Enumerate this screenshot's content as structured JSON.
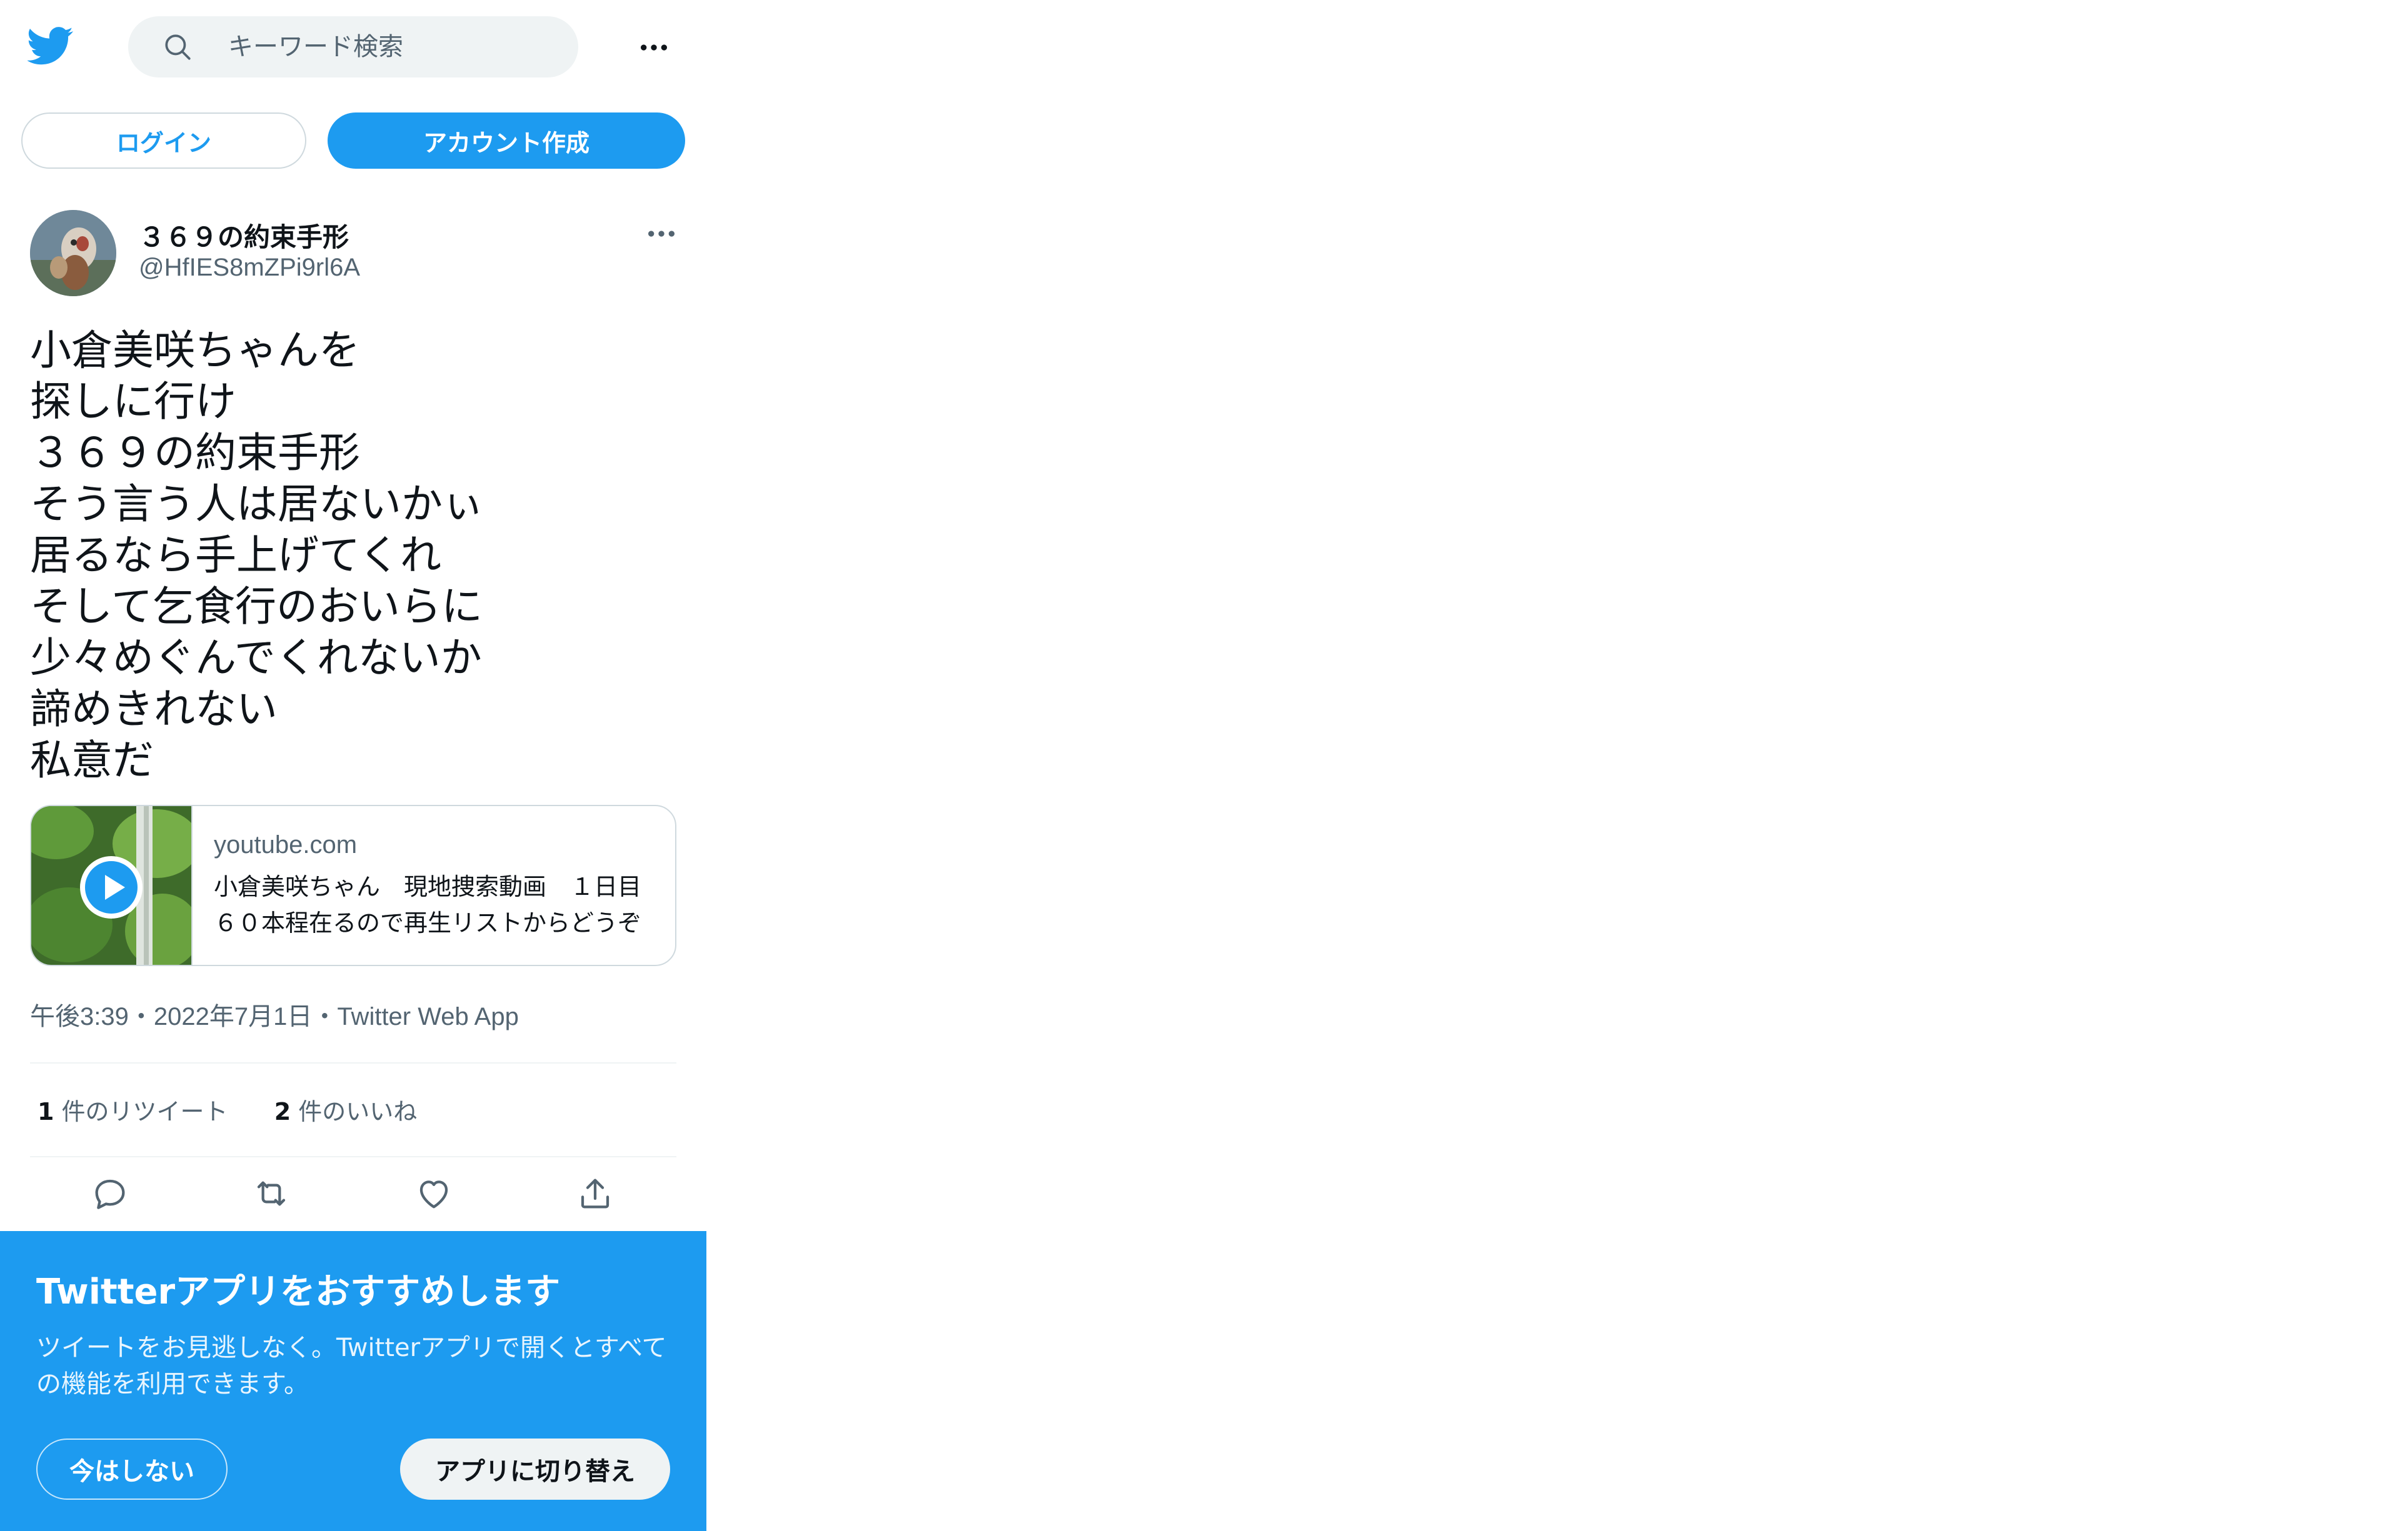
{
  "header": {
    "logo_icon": "twitter-bird-icon",
    "search_placeholder": "キーワード検索",
    "more_icon": "more-horizontal-icon"
  },
  "auth": {
    "login_label": "ログイン",
    "signup_label": "アカウント作成"
  },
  "tweet": {
    "display_name": "３６９の約束手形",
    "handle": "@HfIES8mZPi9rl6A",
    "lines": [
      "小倉美咲ちゃんを",
      "探しに行け",
      "３６９の約束手形",
      "そう言う人は居ないかぃ",
      "居るなら手上げてくれ",
      "そして乞食行のおいらに",
      "少々めぐんでくれないか",
      "諦めきれない",
      "私意だ"
    ],
    "card": {
      "domain": "youtube.com",
      "title": "小倉美咲ちゃん　現地捜索動画　１日目　６０本程在るので再生リストからどうぞ"
    },
    "meta": "午後3:39・2022年7月1日・Twitter Web App",
    "stats": {
      "retweets_count": "1",
      "retweets_label": "件のリツイート",
      "likes_count": "2",
      "likes_label": "件のいいね"
    }
  },
  "banner": {
    "title": "Twitterアプリをおすすめします",
    "text": "ツイートをお見逃しなく。Twitterアプリで開くとすべての機能を利用できます。",
    "not_now_label": "今はしない",
    "switch_label": "アプリに切り替え"
  },
  "colors": {
    "brand": "#1d9bf0",
    "text_primary": "#0f1419",
    "text_secondary": "#536471",
    "border": "#cfd9de"
  }
}
